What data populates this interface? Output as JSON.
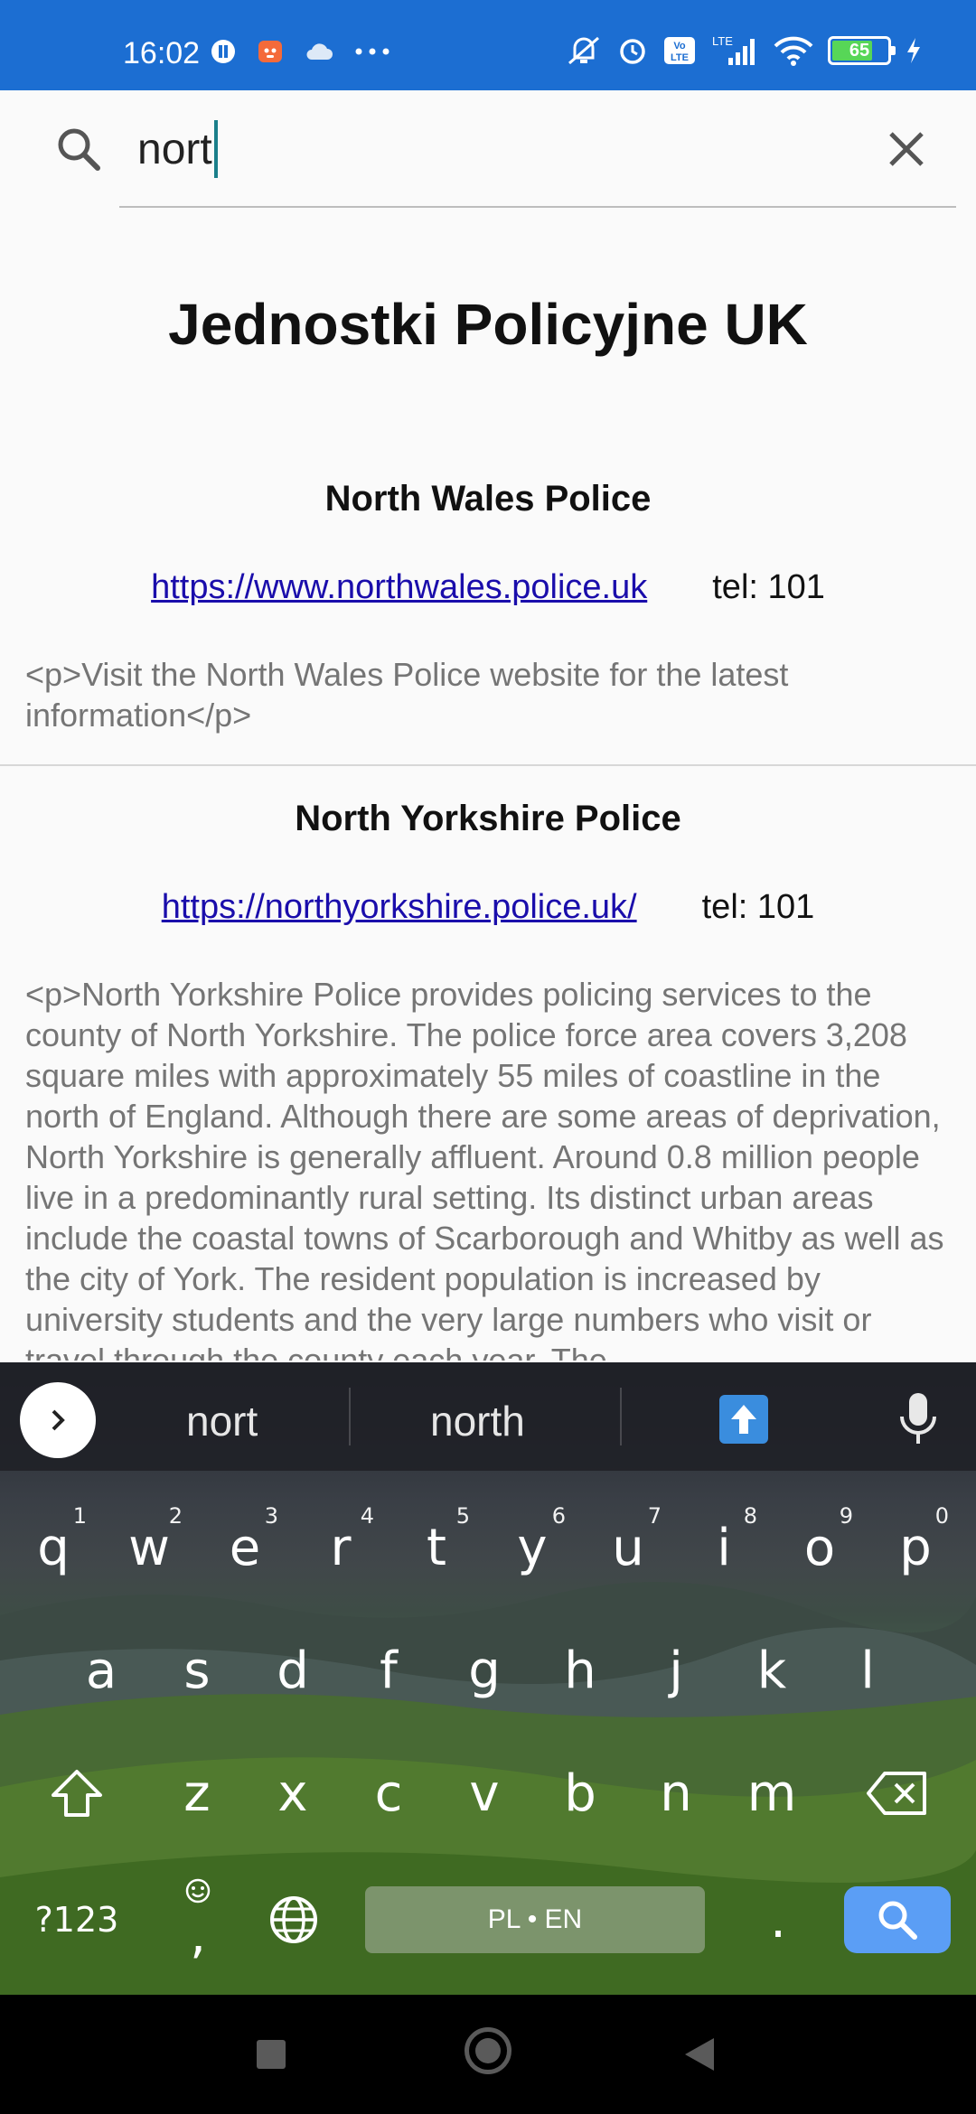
{
  "status_bar": {
    "time": "16:02",
    "battery_level": "65",
    "network_label": "LTE",
    "background_color": "#1c6ed2"
  },
  "search": {
    "value": "nort",
    "icon": "search-icon",
    "clear_icon": "close-icon"
  },
  "page": {
    "title": "Jednostki Policyjne UK"
  },
  "entries": [
    {
      "name": "North Wales Police",
      "url": "https://www.northwales.police.uk",
      "tel": "tel: 101",
      "description": "<p>Visit the North Wales Police website for the latest information</p>"
    },
    {
      "name": "North Yorkshire Police",
      "url": "https://northyorkshire.police.uk/",
      "tel": "tel: 101",
      "description": "<p>North Yorkshire Police provides policing services to the county of North Yorkshire. The police force area covers 3,208 square miles with approximately 55 miles of coastline in the north of England. Although there are some areas of deprivation, North Yorkshire is generally affluent. Around 0.8 million people live in a predominantly rural setting. Its distinct urban areas include the coastal towns of Scarborough and Whitby as well as the city of York. The resident population is increased by university students and the very large numbers who visit or travel through the county each year. The"
    }
  ],
  "keyboard": {
    "suggestions": [
      "nort",
      "north"
    ],
    "row1": [
      {
        "k": "q",
        "n": "1"
      },
      {
        "k": "w",
        "n": "2"
      },
      {
        "k": "e",
        "n": "3"
      },
      {
        "k": "r",
        "n": "4"
      },
      {
        "k": "t",
        "n": "5"
      },
      {
        "k": "y",
        "n": "6"
      },
      {
        "k": "u",
        "n": "7"
      },
      {
        "k": "i",
        "n": "8"
      },
      {
        "k": "o",
        "n": "9"
      },
      {
        "k": "p",
        "n": "0"
      }
    ],
    "row2": [
      "a",
      "s",
      "d",
      "f",
      "g",
      "h",
      "j",
      "k",
      "l"
    ],
    "row3": [
      "z",
      "x",
      "c",
      "v",
      "b",
      "n",
      "m"
    ],
    "symbols_label": "?123",
    "comma_label": ",",
    "period_label": ".",
    "space_label": "PL • EN",
    "accent_color": "#5b9ef5"
  }
}
